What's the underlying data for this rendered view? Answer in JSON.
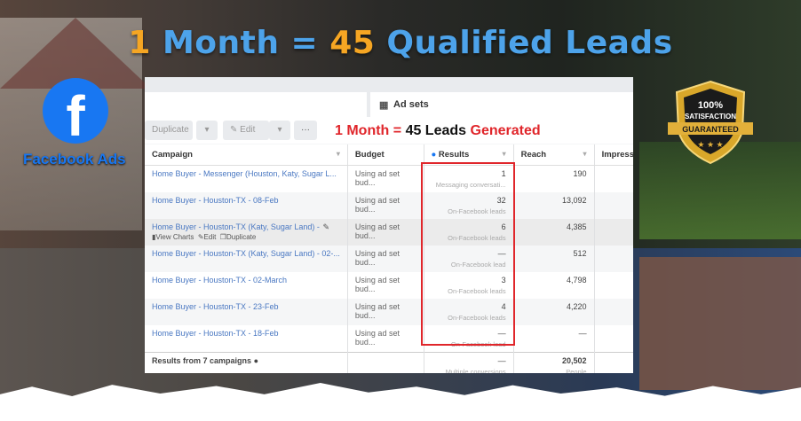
{
  "title": {
    "p1": "1",
    "p2": " Month = ",
    "p3": "45",
    "p4": " Qualified Leads"
  },
  "logo": {
    "letter": "f",
    "label": "Facebook Ads"
  },
  "badge": {
    "line1": "100%",
    "line2": "SATISFACTION",
    "line3": "GUARANTEED"
  },
  "tabs": {
    "ad_sets": "Ad sets",
    "ad_sets_icon": "grid-icon"
  },
  "toolbar": {
    "duplicate": "Duplicate",
    "edit": "Edit",
    "more": "···"
  },
  "headline": {
    "a": "1 Month = ",
    "b": "45 Leads ",
    "c": "Generated"
  },
  "columns": [
    "Campaign",
    "Budget",
    "Results",
    "Reach",
    "Impress"
  ],
  "rows": [
    {
      "campaign": "Home Buyer - Messenger (Houston, Katy, Sugar L...",
      "budget": "Using ad set bud...",
      "result": "1",
      "result_type": "Messaging conversati...",
      "reach": "190"
    },
    {
      "campaign": "Home Buyer - Houston-TX - 08-Feb",
      "budget": "Using ad set bud...",
      "result": "32",
      "result_type": "On-Facebook leads",
      "reach": "13,092"
    },
    {
      "campaign": "Home Buyer - Houston-TX (Katy, Sugar Land) - ...",
      "budget": "Using ad set bud...",
      "result": "6",
      "result_type": "On-Facebook leads",
      "reach": "4,385",
      "actions": [
        "View Charts",
        "Edit",
        "Duplicate"
      ]
    },
    {
      "campaign": "Home Buyer - Houston-TX (Katy, Sugar Land) - 02-...",
      "budget": "Using ad set bud...",
      "result": "—",
      "result_type": "On-Facebook lead",
      "reach": "512"
    },
    {
      "campaign": "Home Buyer - Houston-TX - 02-March",
      "budget": "Using ad set bud...",
      "result": "3",
      "result_type": "On-Facebook leads",
      "reach": "4,798"
    },
    {
      "campaign": "Home Buyer - Houston-TX - 23-Feb",
      "budget": "Using ad set bud...",
      "result": "4",
      "result_type": "On-Facebook leads",
      "reach": "4,220"
    },
    {
      "campaign": "Home Buyer - Houston-TX - 18-Feb",
      "budget": "Using ad set bud...",
      "result": "—",
      "result_type": "On-Facebook lead",
      "reach": "—"
    }
  ],
  "totals": {
    "label": "Results from 7 campaigns",
    "result": "—",
    "result_type": "Multiple conversions",
    "reach": "20,502",
    "reach_type": "People"
  },
  "colors": {
    "fb_blue": "#1877f2",
    "title_blue": "#4da3ea",
    "title_orange": "#f6a623",
    "highlight_red": "#e0262b"
  }
}
